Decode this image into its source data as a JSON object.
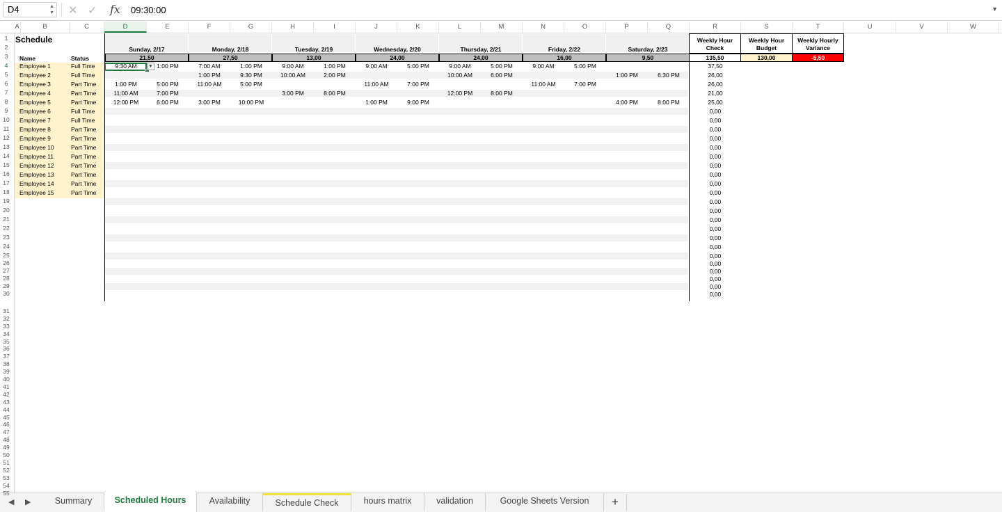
{
  "formula_bar": {
    "name_box": "D4",
    "fx": "fx",
    "formula": "09:30:00"
  },
  "columns": [
    "A",
    "B",
    "C",
    "D",
    "E",
    "F",
    "G",
    "H",
    "I",
    "J",
    "K",
    "L",
    "M",
    "N",
    "O",
    "P",
    "Q",
    "R",
    "S",
    "T",
    "U",
    "V",
    "W"
  ],
  "title": "Schedule",
  "name_header": "Name",
  "status_header": "Status",
  "days": [
    {
      "label": "Sunday, 2/17",
      "total": "21,50"
    },
    {
      "label": "Monday, 2/18",
      "total": "27,50"
    },
    {
      "label": "Tuesday, 2/19",
      "total": "13,00"
    },
    {
      "label": "Wednesday, 2/20",
      "total": "24,00"
    },
    {
      "label": "Thursday, 2/21",
      "total": "24,00"
    },
    {
      "label": "Friday, 2/22",
      "total": "16,00"
    },
    {
      "label": "Saturday, 2/23",
      "total": "9,50"
    }
  ],
  "weekly_check": {
    "label": "Weekly Hour Check",
    "total": "135,50"
  },
  "weekly_budget": {
    "label": "Weekly Hour Budget",
    "value": "130,00"
  },
  "weekly_variance": {
    "label": "Weekly Hourly Variance",
    "value": "-5,50"
  },
  "employees": [
    {
      "name": "Employee 1",
      "status": "Full Time",
      "hours": "37,50",
      "shifts": [
        [
          "9:30 AM",
          "1:00 PM"
        ],
        [
          "7:00 AM",
          "1:00 PM"
        ],
        [
          "9:00 AM",
          "1:00 PM"
        ],
        [
          "9:00 AM",
          "5:00 PM"
        ],
        [
          "9:00 AM",
          "5:00 PM"
        ],
        [
          "9:00 AM",
          "5:00 PM"
        ],
        [
          "",
          ""
        ]
      ]
    },
    {
      "name": "Employee 2",
      "status": "Full Time",
      "hours": "26,00",
      "shifts": [
        [
          "",
          ""
        ],
        [
          "1:00 PM",
          "9:30 PM"
        ],
        [
          "10:00 AM",
          "2:00 PM"
        ],
        [
          "",
          ""
        ],
        [
          "10:00 AM",
          "6:00 PM"
        ],
        [
          "",
          ""
        ],
        [
          "1:00 PM",
          "6:30 PM"
        ]
      ]
    },
    {
      "name": "Employee 3",
      "status": "Part Time",
      "hours": "26,00",
      "shifts": [
        [
          "1:00 PM",
          "5:00 PM"
        ],
        [
          "11:00 AM",
          "5:00 PM"
        ],
        [
          "",
          ""
        ],
        [
          "11:00 AM",
          "7:00 PM"
        ],
        [
          "",
          ""
        ],
        [
          "11:00 AM",
          "7:00 PM"
        ],
        [
          "",
          ""
        ]
      ]
    },
    {
      "name": "Employee 4",
      "status": "Part Time",
      "hours": "21,00",
      "shifts": [
        [
          "11:00 AM",
          "7:00 PM"
        ],
        [
          "",
          ""
        ],
        [
          "3:00 PM",
          "8:00 PM"
        ],
        [
          "",
          ""
        ],
        [
          "12:00 PM",
          "8:00 PM"
        ],
        [
          "",
          ""
        ],
        [
          "",
          ""
        ]
      ]
    },
    {
      "name": "Employee 5",
      "status": "Part Time",
      "hours": "25,00",
      "shifts": [
        [
          "12:00 PM",
          "6:00 PM"
        ],
        [
          "3:00 PM",
          "10:00 PM"
        ],
        [
          "",
          ""
        ],
        [
          "1:00 PM",
          "9:00 PM"
        ],
        [
          "",
          ""
        ],
        [
          "",
          ""
        ],
        [
          "4:00 PM",
          "8:00 PM"
        ]
      ]
    },
    {
      "name": "Employee 6",
      "status": "Full Time",
      "hours": "0,00",
      "shifts": []
    },
    {
      "name": "Employee 7",
      "status": "Full Time",
      "hours": "0,00",
      "shifts": []
    },
    {
      "name": "Employee 8",
      "status": "Part Time",
      "hours": "0,00",
      "shifts": []
    },
    {
      "name": "Employee 9",
      "status": "Part Time",
      "hours": "0,00",
      "shifts": []
    },
    {
      "name": "Employee 10",
      "status": "Part Time",
      "hours": "0,00",
      "shifts": []
    },
    {
      "name": "Employee 11",
      "status": "Part Time",
      "hours": "0,00",
      "shifts": []
    },
    {
      "name": "Employee 12",
      "status": "Part Time",
      "hours": "0,00",
      "shifts": []
    },
    {
      "name": "Employee 13",
      "status": "Part Time",
      "hours": "0,00",
      "shifts": []
    },
    {
      "name": "Employee 14",
      "status": "Part Time",
      "hours": "0,00",
      "shifts": []
    },
    {
      "name": "Employee 15",
      "status": "Part Time",
      "hours": "0,00",
      "shifts": []
    }
  ],
  "extra_hours": [
    "0,00",
    "0,00",
    "0,00",
    "0,00",
    "0,00",
    "0,00",
    "0,00",
    "0,00",
    "0,00",
    "0,00",
    "0,00",
    "0,00"
  ],
  "sheet_tabs": [
    "Summary",
    "Scheduled Hours",
    "Availability",
    "Schedule Check",
    "hours matrix",
    "validation",
    "Google Sheets Version"
  ],
  "active_tab": "Scheduled Hours",
  "colors": {
    "accent": "#1f7a3f",
    "yellow": "#fff2cc",
    "variance_red": "#ff0000",
    "total_gray": "#bfbfbf"
  }
}
